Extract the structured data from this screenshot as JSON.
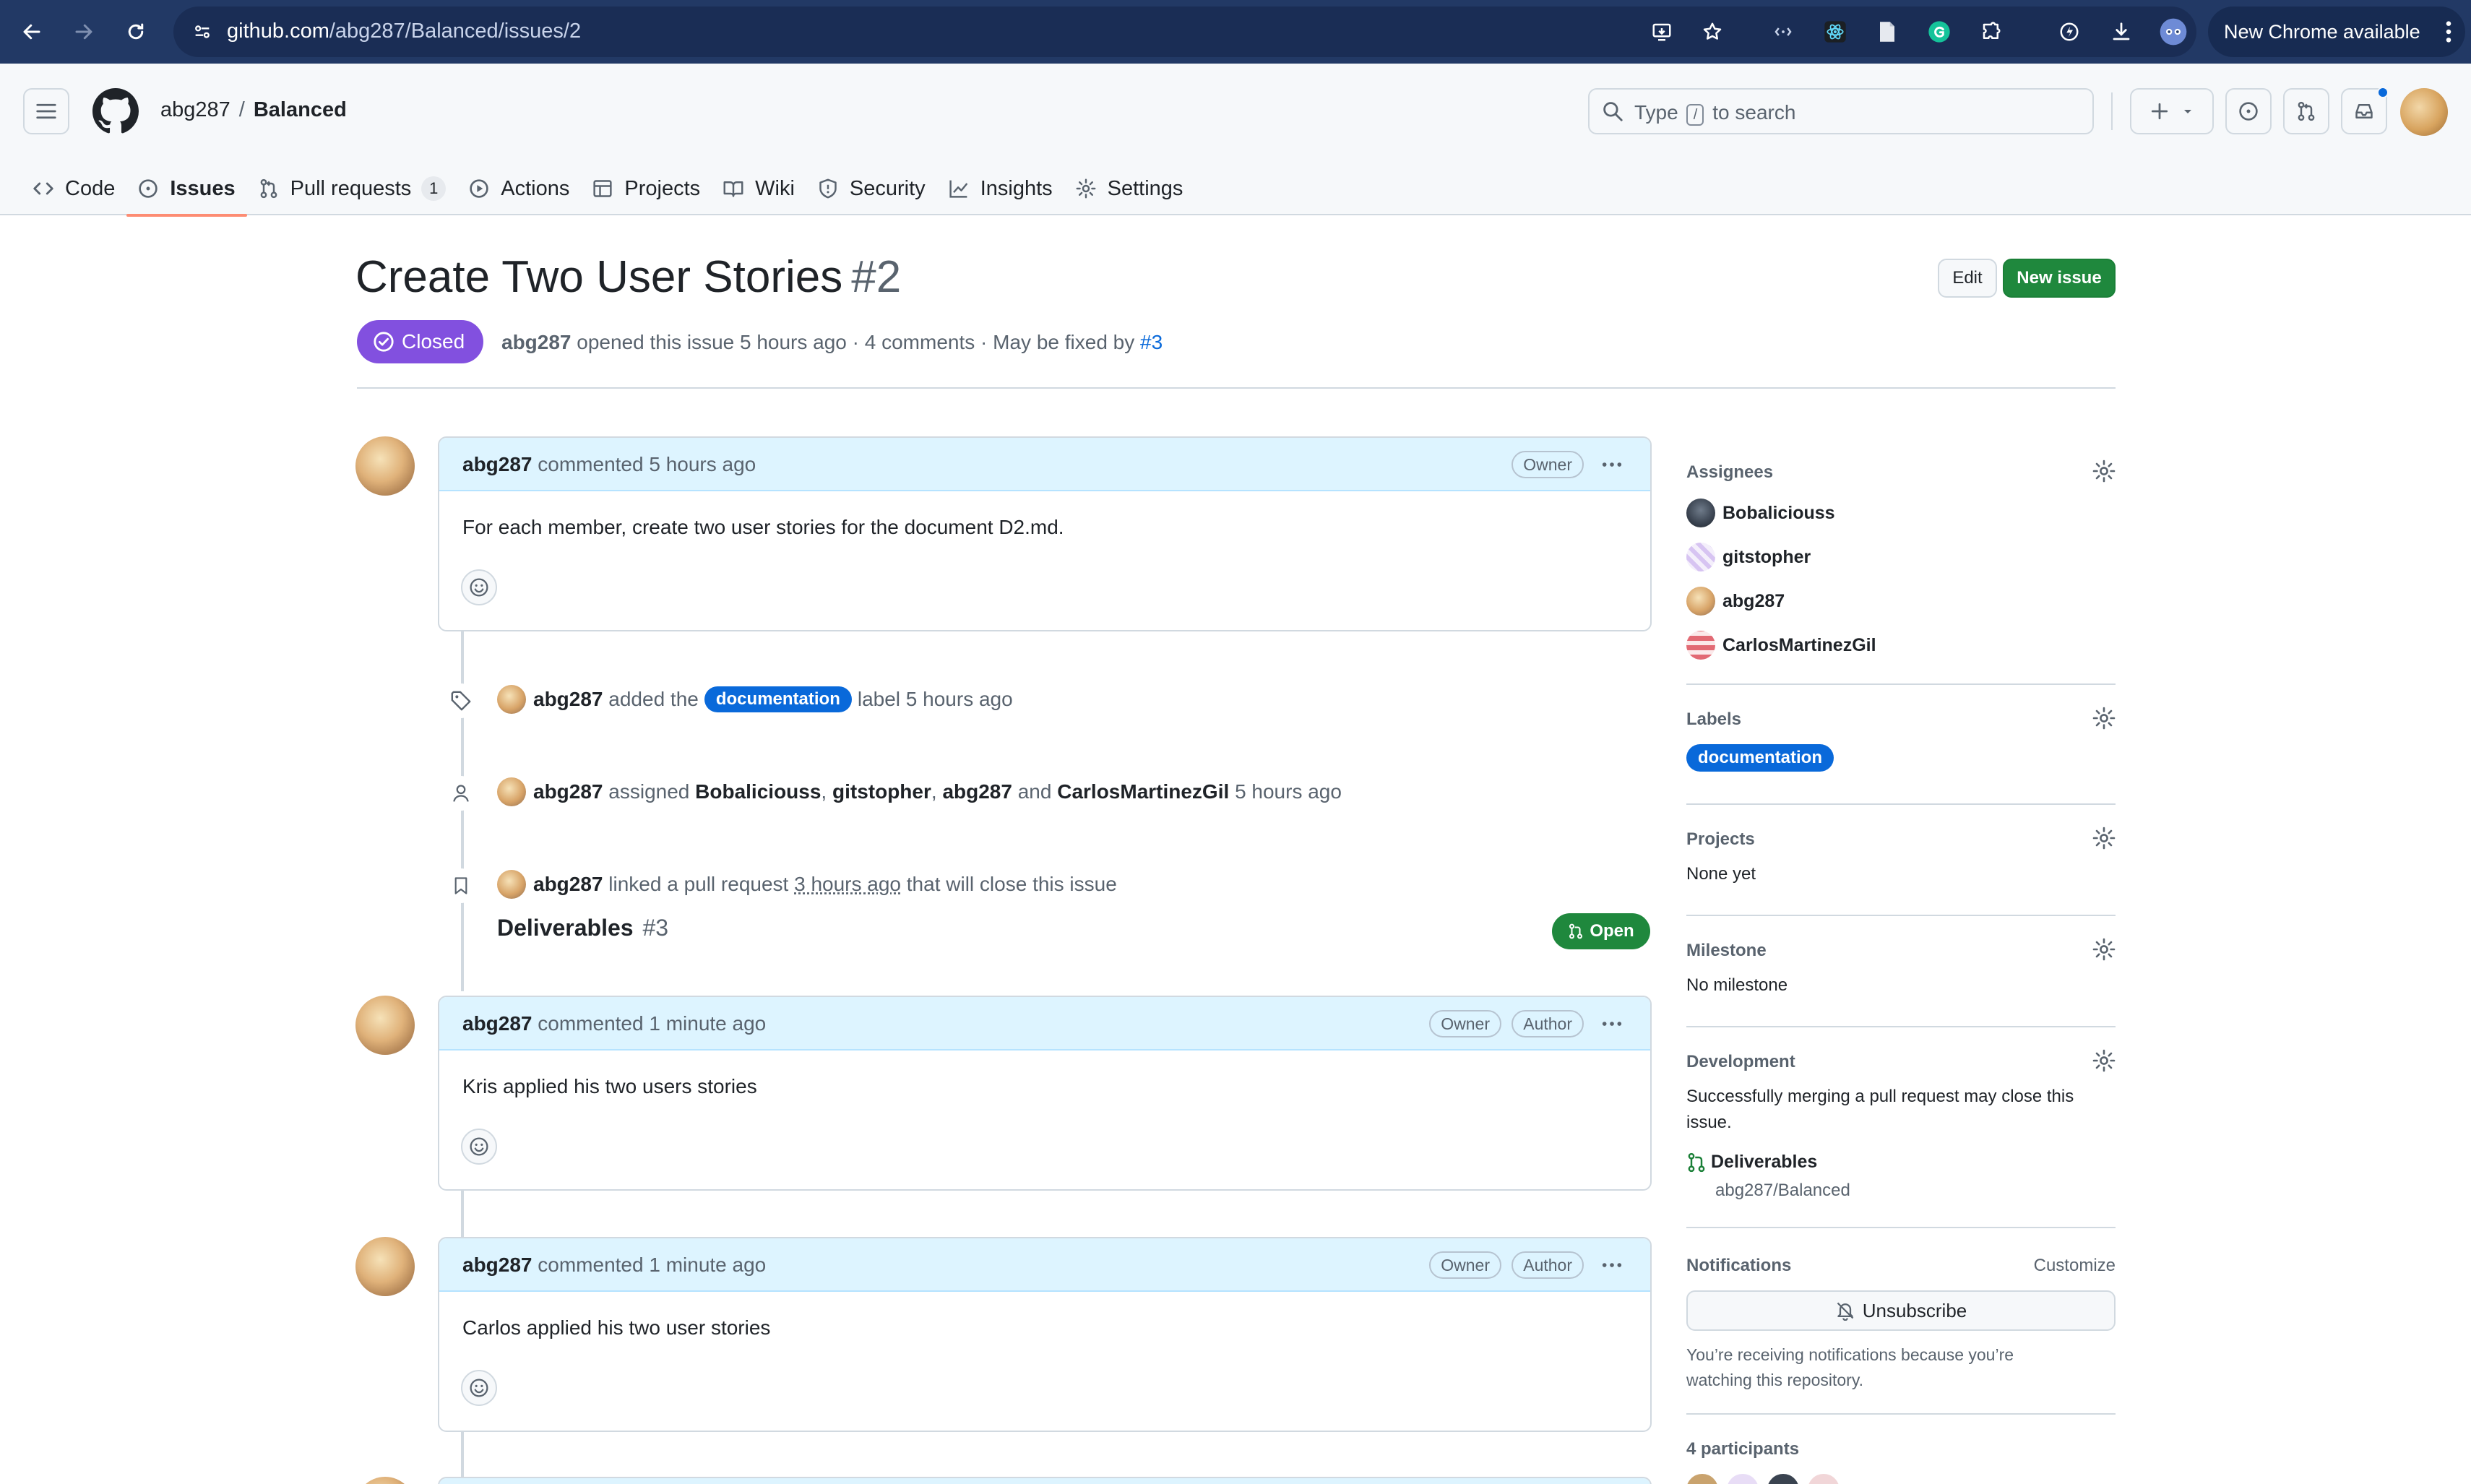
{
  "browser": {
    "url_host": "github.com",
    "url_path": "/abg287/Balanced/issues/2",
    "update_label": "New Chrome available"
  },
  "header": {
    "owner": "abg287",
    "separator": "/",
    "repo": "Balanced",
    "search_prefix": "Type",
    "search_key": "/",
    "search_suffix": "to search"
  },
  "repo_nav": {
    "code": "Code",
    "issues": "Issues",
    "pull_requests": "Pull requests",
    "pull_requests_count": "1",
    "actions": "Actions",
    "projects": "Projects",
    "wiki": "Wiki",
    "security": "Security",
    "insights": "Insights",
    "settings": "Settings"
  },
  "issue": {
    "title": "Create Two User Stories",
    "number": "#2",
    "edit_label": "Edit",
    "new_issue_label": "New issue",
    "state": "Closed",
    "author": "abg287",
    "meta_text": "opened this issue 5 hours ago · 4 comments · May be fixed by",
    "fixed_by": "#3"
  },
  "comments": [
    {
      "author": "abg287",
      "action": "commented 5 hours ago",
      "roles": [
        "Owner"
      ],
      "body": "For each member, create two user stories for the document D2.md."
    },
    {
      "author": "abg287",
      "action": "commented 1 minute ago",
      "roles": [
        "Owner",
        "Author"
      ],
      "body": "Kris applied his two users stories"
    },
    {
      "author": "abg287",
      "action": "commented 1 minute ago",
      "roles": [
        "Owner",
        "Author"
      ],
      "body": "Carlos applied his two user stories"
    }
  ],
  "events": {
    "label": {
      "actor": "abg287",
      "pre": "added the",
      "label": "documentation",
      "post": "label 5 hours ago"
    },
    "assign": {
      "actor": "abg287",
      "pre": "assigned",
      "u1": "Bobaliciouss",
      "sep1": ",",
      "u2": "gitstopher",
      "sep2": ",",
      "u3": "abg287",
      "and": "and",
      "u4": "CarlosMartinezGil",
      "post": "5 hours ago"
    },
    "link": {
      "actor": "abg287",
      "pre": "linked a pull request",
      "time": "3 hours ago",
      "post": "that will close this issue",
      "pr_title": "Deliverables",
      "pr_number": "#3",
      "pr_state": "Open"
    }
  },
  "sidebar": {
    "assignees_title": "Assignees",
    "assignees": [
      "Bobaliciouss",
      "gitstopher",
      "abg287",
      "CarlosMartinezGil"
    ],
    "labels_title": "Labels",
    "label": "documentation",
    "projects_title": "Projects",
    "projects_value": "None yet",
    "milestone_title": "Milestone",
    "milestone_value": "No milestone",
    "development_title": "Development",
    "development_text": "Successfully merging a pull request may close this issue.",
    "dev_pr_title": "Deliverables",
    "dev_pr_repo": "abg287/Balanced",
    "notifications_title": "Notifications",
    "customize": "Customize",
    "unsubscribe": "Unsubscribe",
    "notifications_text": "You’re receiving notifications because you’re watching this repository.",
    "participants": "4 participants"
  },
  "colors": {
    "chrome_bar": "#223965",
    "closed_badge": "#8250df",
    "primary_button": "#1f883d",
    "label_blue": "#0969da",
    "comment_header": "#ddf4ff"
  }
}
